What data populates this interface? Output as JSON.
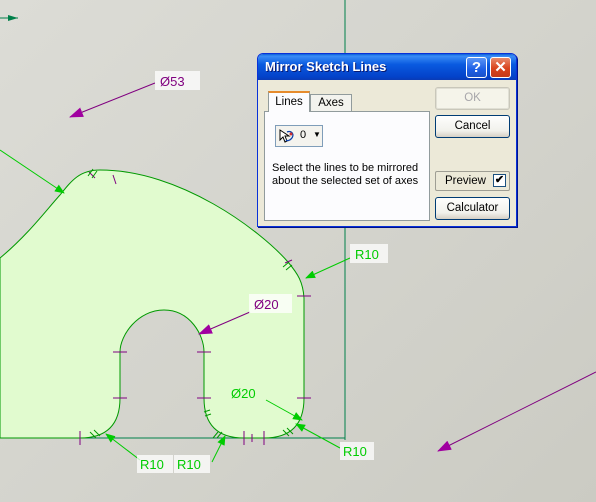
{
  "dialog": {
    "title": "Mirror Sketch Lines",
    "help_symbol": "?",
    "close_symbol": "✕",
    "tabs": [
      {
        "label": "Lines",
        "active": true
      },
      {
        "label": "Axes",
        "active": false
      }
    ],
    "selector_count": "0",
    "selector_icon": "select-lines-icon",
    "instruction": "Select the lines to be mirrored about the selected set of axes",
    "buttons": {
      "ok": "OK",
      "ok_enabled": false,
      "cancel": "Cancel",
      "preview": "Preview",
      "preview_checked": true,
      "calculator": "Calculator"
    }
  },
  "sketch": {
    "dimensions": [
      {
        "id": "dia-53",
        "text": "Ø53",
        "color": "#800080"
      },
      {
        "id": "r10-top-right",
        "text": "R10",
        "color": "#00cc00"
      },
      {
        "id": "dia-20-slot",
        "text": "Ø20",
        "color": "#800080"
      },
      {
        "id": "dia-20-lower",
        "text": "Ø20",
        "color": "#00cc00"
      },
      {
        "id": "r10-bottom-right",
        "text": "R10",
        "color": "#00cc00"
      },
      {
        "id": "r10-bottom-left",
        "text": "R10",
        "color": "#00cc00"
      },
      {
        "id": "r10-bottom-middle",
        "text": "R10",
        "color": "#00cc00"
      }
    ],
    "colors": {
      "fill": "#e1fbcf",
      "outline": "#009900",
      "axis": "#00804a",
      "dim_purple": "#800080",
      "dim_green": "#00cc00"
    }
  }
}
